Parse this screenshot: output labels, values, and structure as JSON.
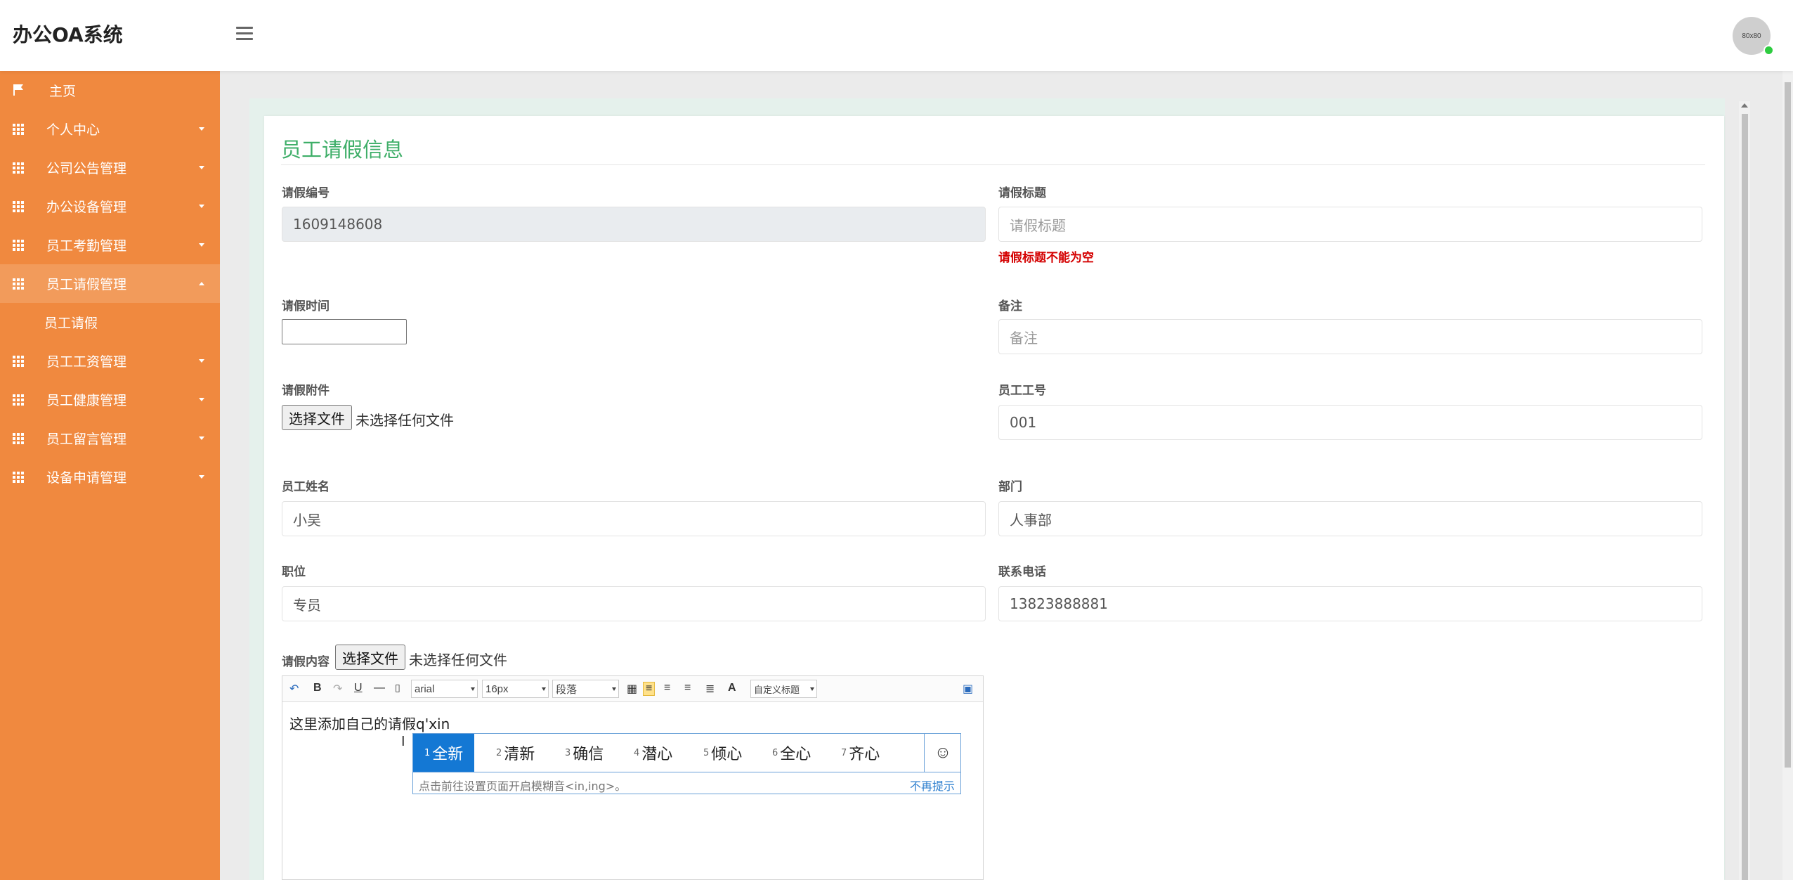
{
  "header": {
    "brand": "办公OA系统",
    "avatar_text": "80x80"
  },
  "sidebar": {
    "home": "主页",
    "items": [
      {
        "label": "个人中心"
      },
      {
        "label": "公司公告管理"
      },
      {
        "label": "办公设备管理"
      },
      {
        "label": "员工考勤管理"
      },
      {
        "label": "员工请假管理"
      },
      {
        "label": "员工工资管理"
      },
      {
        "label": "员工健康管理"
      },
      {
        "label": "员工留言管理"
      },
      {
        "label": "设备申请管理"
      }
    ],
    "sub_item": "员工请假"
  },
  "form": {
    "title": "员工请假信息",
    "leave_no": {
      "label": "请假编号",
      "value": "1609148608"
    },
    "leave_title": {
      "label": "请假标题",
      "placeholder": "请假标题",
      "error": "请假标题不能为空"
    },
    "leave_time": {
      "label": "请假时间"
    },
    "remark": {
      "label": "备注",
      "placeholder": "备注"
    },
    "attachment": {
      "label": "请假附件",
      "button": "选择文件",
      "status": "未选择任何文件"
    },
    "emp_no": {
      "label": "员工工号",
      "value": "001"
    },
    "emp_name": {
      "label": "员工姓名",
      "value": "小吴"
    },
    "department": {
      "label": "部门",
      "value": "人事部"
    },
    "position": {
      "label": "职位",
      "value": "专员"
    },
    "phone": {
      "label": "联系电话",
      "value": "13823888881"
    },
    "content": {
      "label": "请假内容",
      "button": "选择文件",
      "status": "未选择任何文件"
    }
  },
  "editor": {
    "font": "arial",
    "size": "16px",
    "paragraph": "段落",
    "custom_title": "自定义标题",
    "text": "这里添加自己的请假q'xin",
    "cursor_glyph": "I"
  },
  "ime": {
    "candidates": [
      {
        "num": "1",
        "text": "全新"
      },
      {
        "num": "2",
        "text": "清新"
      },
      {
        "num": "3",
        "text": "确信"
      },
      {
        "num": "4",
        "text": "潜心"
      },
      {
        "num": "5",
        "text": "倾心"
      },
      {
        "num": "6",
        "text": "全心"
      },
      {
        "num": "7",
        "text": "齐心"
      }
    ],
    "hint": "点击前往设置页面开启模糊音<in,ing>。",
    "dismiss": "不再提示",
    "emoji_icon": "smiley-icon"
  }
}
